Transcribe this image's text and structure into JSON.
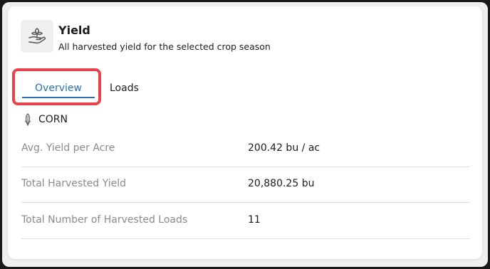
{
  "header": {
    "icon": "harvest-hand-icon",
    "title": "Yield",
    "subtitle": "All harvested yield for the selected crop season"
  },
  "tabs": [
    {
      "label": "Overview",
      "active": true
    },
    {
      "label": "Loads",
      "active": false
    }
  ],
  "crop": {
    "icon": "corn-icon",
    "name": "CORN"
  },
  "stats": [
    {
      "label": "Avg. Yield per Acre",
      "value": "200.42 bu / ac"
    },
    {
      "label": "Total Harvested Yield",
      "value": "20,880.25 bu"
    },
    {
      "label": "Total Number of Harvested Loads",
      "value": "11"
    }
  ],
  "colors": {
    "accent": "#2a6fb0",
    "highlight": "#e8424a",
    "muted_text": "#8a8a8a"
  }
}
